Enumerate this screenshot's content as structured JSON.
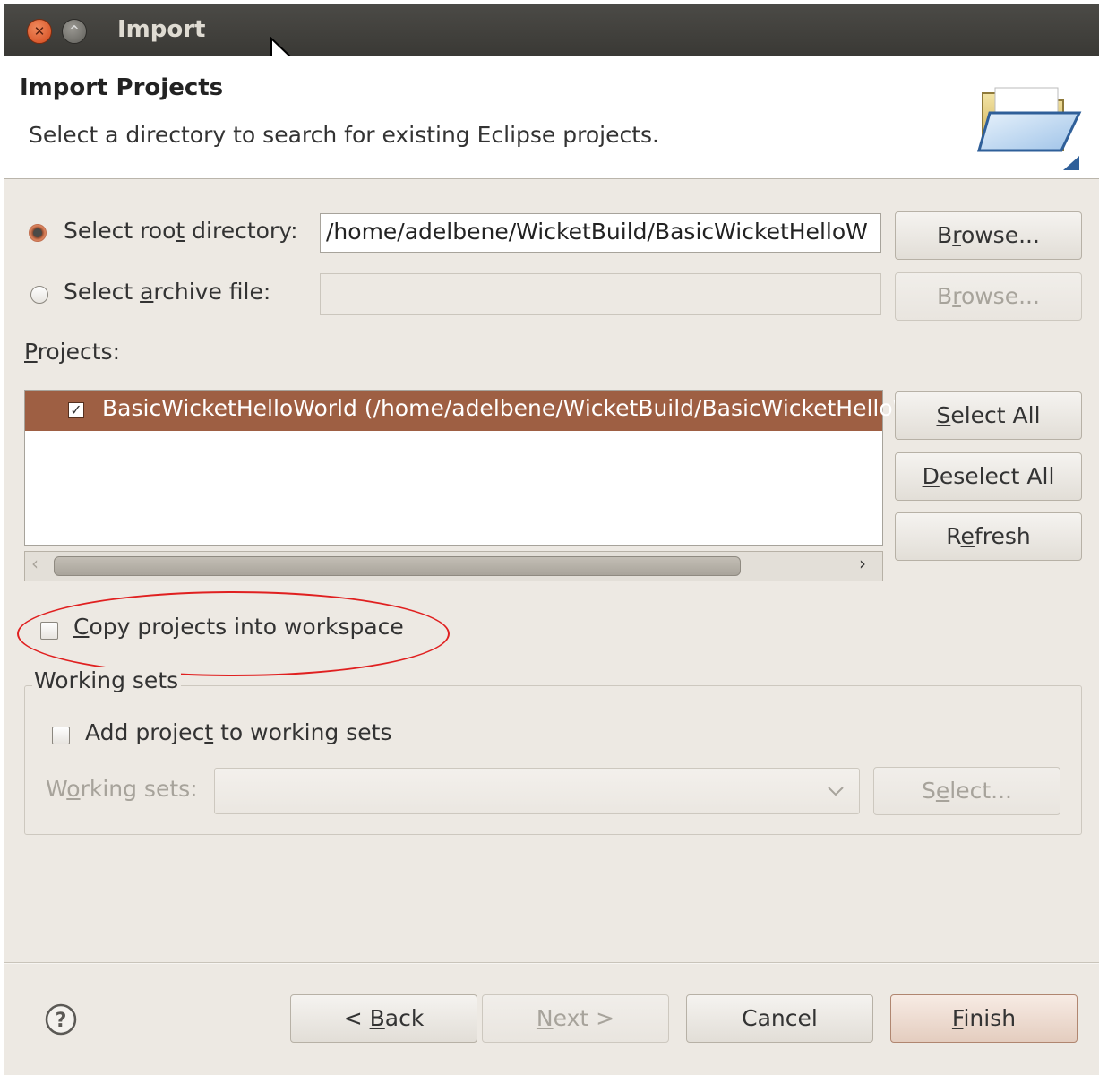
{
  "window": {
    "title": "Import",
    "close_glyph": "✕",
    "minimize_glyph": "^"
  },
  "header": {
    "title": "Import Projects",
    "description": "Select a directory to search for existing Eclipse projects.",
    "icon": "open-folder-icon"
  },
  "source": {
    "root_dir": {
      "label_before": "Select roo",
      "label_mnemonic": "t",
      "label_after": " directory:",
      "selected": true,
      "value": "/home/adelbene/WicketBuild/BasicWicketHelloW",
      "browse_before": "B",
      "browse_mnemonic": "r",
      "browse_after": "owse..."
    },
    "archive": {
      "label_before": "Select ",
      "label_mnemonic": "a",
      "label_after": "rchive file:",
      "selected": false,
      "value": "",
      "browse_before": "B",
      "browse_mnemonic": "r",
      "browse_after": "owse..."
    }
  },
  "projects": {
    "label_mnemonic": "P",
    "label_after": "rojects:",
    "items": [
      {
        "label": "BasicWicketHelloWorld (/home/adelbene/WicketBuild/BasicWicketHelloWorld)",
        "checked": true
      }
    ],
    "select_all": {
      "before": "",
      "mnemonic": "S",
      "after": "elect All"
    },
    "deselect_all": {
      "before": "",
      "mnemonic": "D",
      "after": "eselect All"
    },
    "refresh": {
      "before": "R",
      "mnemonic": "e",
      "after": "fresh"
    },
    "scroll_left": "‹",
    "scroll_right": "›"
  },
  "options": {
    "copy_projects": {
      "mnemonic": "C",
      "after": "opy projects into workspace",
      "checked": false
    }
  },
  "working_sets": {
    "legend": "Working sets",
    "add_label_before": "Add projec",
    "add_label_mnemonic": "t",
    "add_label_after": " to working sets",
    "add_checked": false,
    "combo_label_before": "W",
    "combo_label_mnemonic": "o",
    "combo_label_after": "rking sets:",
    "combo_value": "",
    "select_before": "S",
    "select_mnemonic": "e",
    "select_after": "lect..."
  },
  "footer": {
    "help_glyph": "?",
    "back": {
      "before": "< ",
      "mnemonic": "B",
      "after": "ack"
    },
    "next": {
      "before": "",
      "mnemonic": "N",
      "after": "ext >"
    },
    "cancel": "Cancel",
    "finish": {
      "before": "",
      "mnemonic": "F",
      "after": "inish"
    }
  },
  "colors": {
    "selection": "#9e5f43",
    "dialog_bg": "#ede9e3",
    "annotation": "#e02020"
  }
}
